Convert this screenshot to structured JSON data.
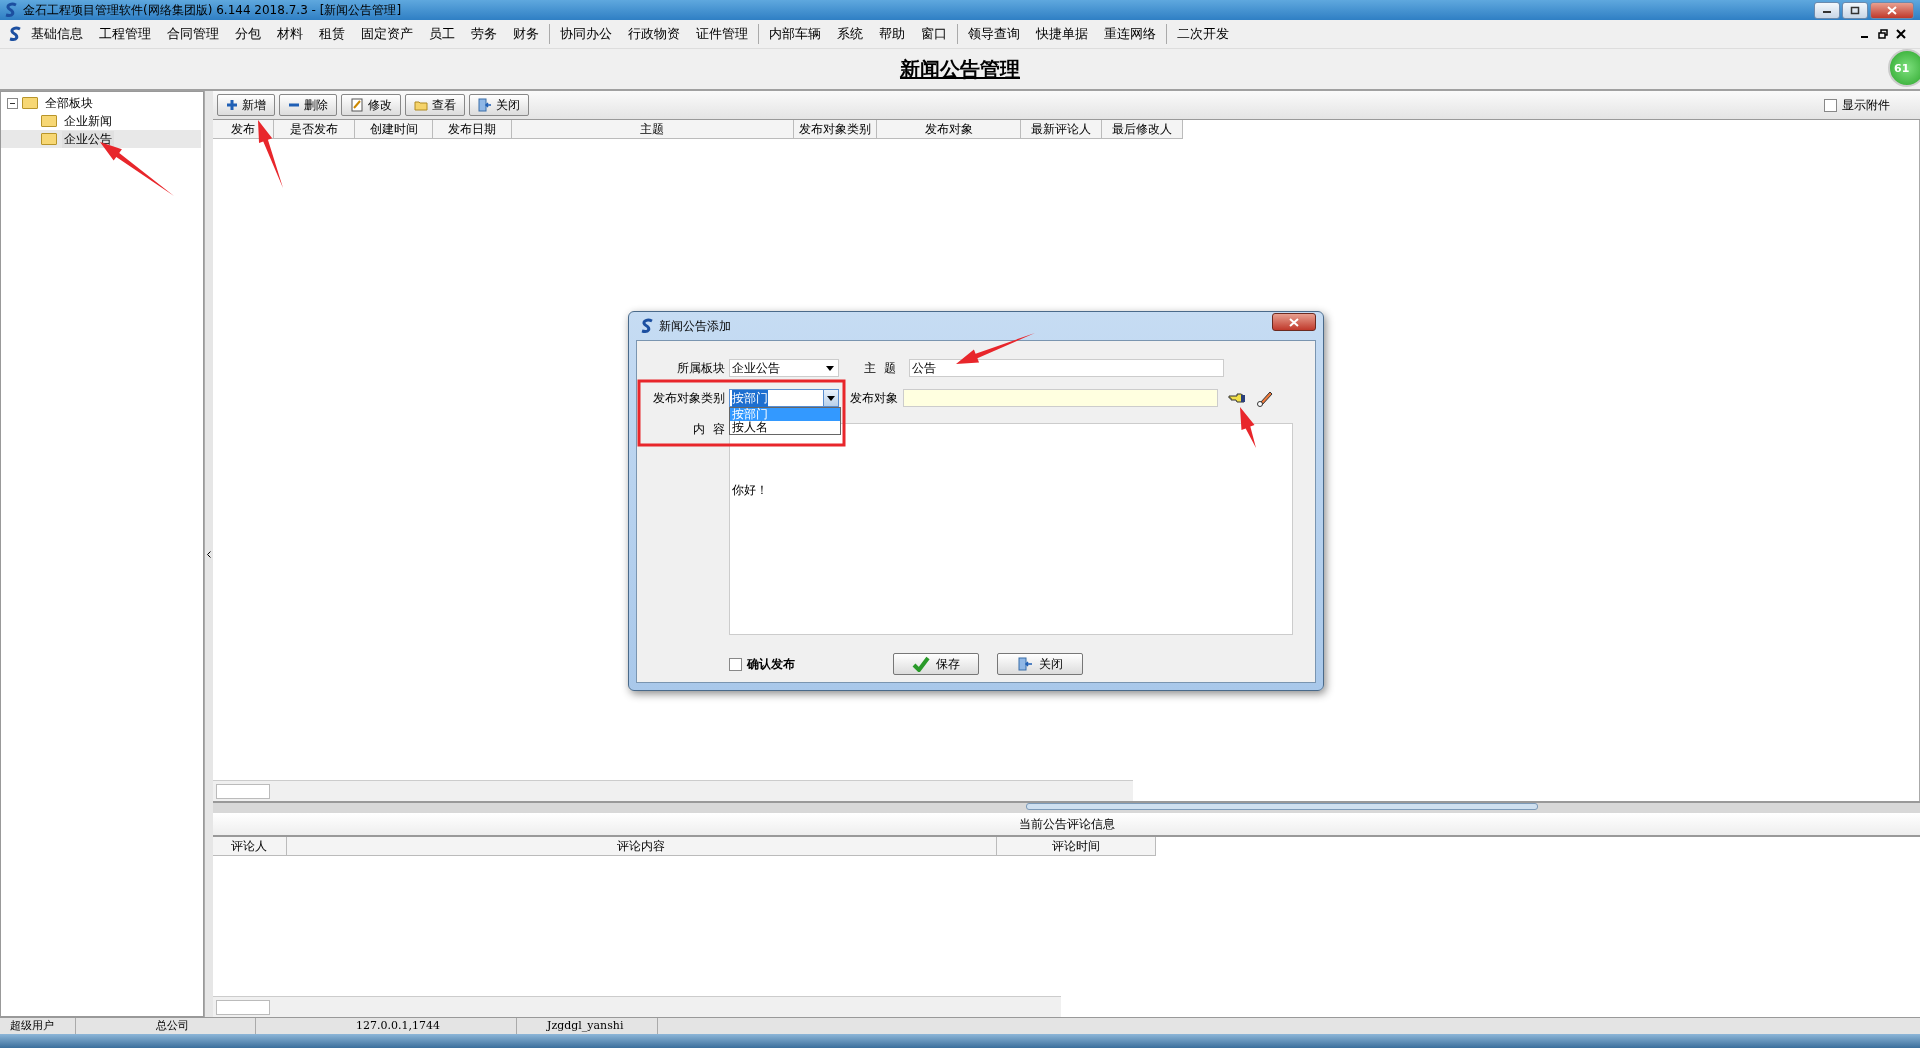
{
  "window": {
    "title": "金石工程项目管理软件(网络集团版) 6.144  2018.7.3 - [新闻公告管理]"
  },
  "menu_groups": [
    [
      "基础信息",
      "工程管理",
      "合同管理",
      "分包",
      "材料",
      "租赁",
      "固定资产",
      "员工",
      "劳务",
      "财务"
    ],
    [
      "协同办公",
      "行政物资",
      "证件管理"
    ],
    [
      "内部车辆",
      "系统",
      "帮助",
      "窗口"
    ],
    [
      "领导查询",
      "快捷单据",
      "重连网络"
    ],
    [
      "二次开发"
    ]
  ],
  "page_title": "新闻公告管理",
  "badge": "61",
  "tree": [
    {
      "label": "全部板块",
      "expanded": true,
      "selected": false,
      "children": [
        {
          "label": "企业新闻",
          "selected": false
        },
        {
          "label": "企业公告",
          "selected": true
        }
      ]
    }
  ],
  "toolbar": [
    {
      "label": "新增",
      "kind": "add"
    },
    {
      "label": "删除",
      "kind": "delete"
    },
    {
      "label": "修改",
      "kind": "edit"
    },
    {
      "label": "查看",
      "kind": "view"
    },
    {
      "label": "关闭",
      "kind": "close"
    }
  ],
  "show_attachments": {
    "label": "显示附件",
    "checked": false
  },
  "table": {
    "columns": [
      "发布",
      "是否发布",
      "创建时间",
      "发布日期",
      "主题",
      "发布对象类别",
      "发布对象",
      "最新评论人",
      "最后修改人"
    ]
  },
  "comments": {
    "title": "当前公告评论信息",
    "columns": [
      "评论人",
      "评论内容",
      "评论时间"
    ]
  },
  "status_bar": [
    "超级用户",
    "总公司",
    "127.0.0.1,1744",
    "Jzgdgl_yanshi"
  ],
  "dialog": {
    "title": "新闻公告添加",
    "board": {
      "label": "所属板块",
      "value": "企业公告"
    },
    "subject": {
      "label": "主  题",
      "value": "公告"
    },
    "target_type": {
      "label": "发布对象类别",
      "value": "按部门",
      "expanded": true,
      "options": [
        {
          "label": "按部门",
          "selected": true
        },
        {
          "label": "按人名",
          "selected": false
        }
      ]
    },
    "target": {
      "label": "发布对象"
    },
    "content": {
      "label": "内  容",
      "value": "你好！"
    },
    "confirm": {
      "label": "确认发布",
      "checked": false
    },
    "buttons": [
      {
        "label": "保存",
        "kind": "save"
      },
      {
        "label": "关闭",
        "kind": "close"
      }
    ]
  }
}
